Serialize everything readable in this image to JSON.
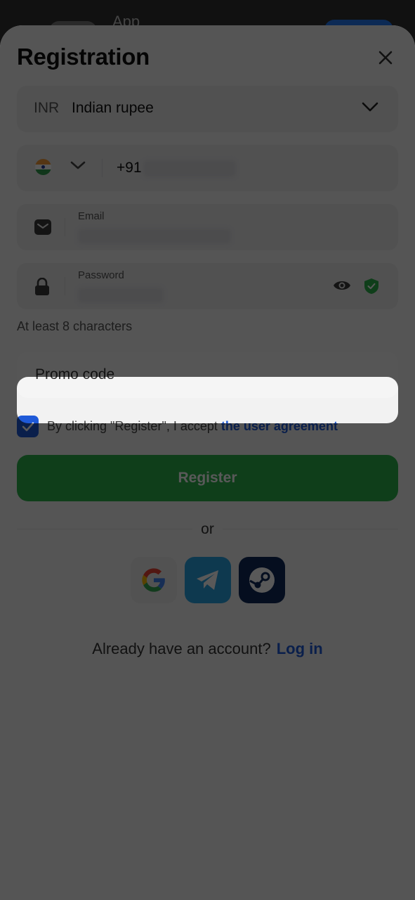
{
  "background_app": {
    "title": "App"
  },
  "sheet": {
    "title": "Registration",
    "close_icon": "close-icon"
  },
  "currency": {
    "code": "INR",
    "name": "Indian rupee",
    "icon": "chevron-down-icon"
  },
  "phone": {
    "prefix": "+91",
    "country": "India",
    "flag_icon": "india-flag-icon"
  },
  "email": {
    "label": "Email",
    "icon": "envelope-icon"
  },
  "password": {
    "label": "Password",
    "icon": "lock-icon",
    "toggle_icon": "eye-icon",
    "strength_icon": "shield-check-icon",
    "hint": "At least 8 characters"
  },
  "promo": {
    "placeholder": "Promo code"
  },
  "agreement": {
    "checked": true,
    "text": "By clicking \"Register\", I accept ",
    "link": "the user agreement"
  },
  "register": {
    "label": "Register"
  },
  "divider": {
    "text": "or"
  },
  "social": [
    {
      "name": "Google",
      "icon": "google-icon"
    },
    {
      "name": "Telegram",
      "icon": "telegram-icon"
    },
    {
      "name": "Steam",
      "icon": "steam-icon"
    }
  ],
  "login": {
    "prompt": "Already have an account?",
    "link": "Log in"
  },
  "colors": {
    "accent": "#1f5ad8",
    "register": "#2bb24c",
    "shield": "#2bb24c"
  }
}
